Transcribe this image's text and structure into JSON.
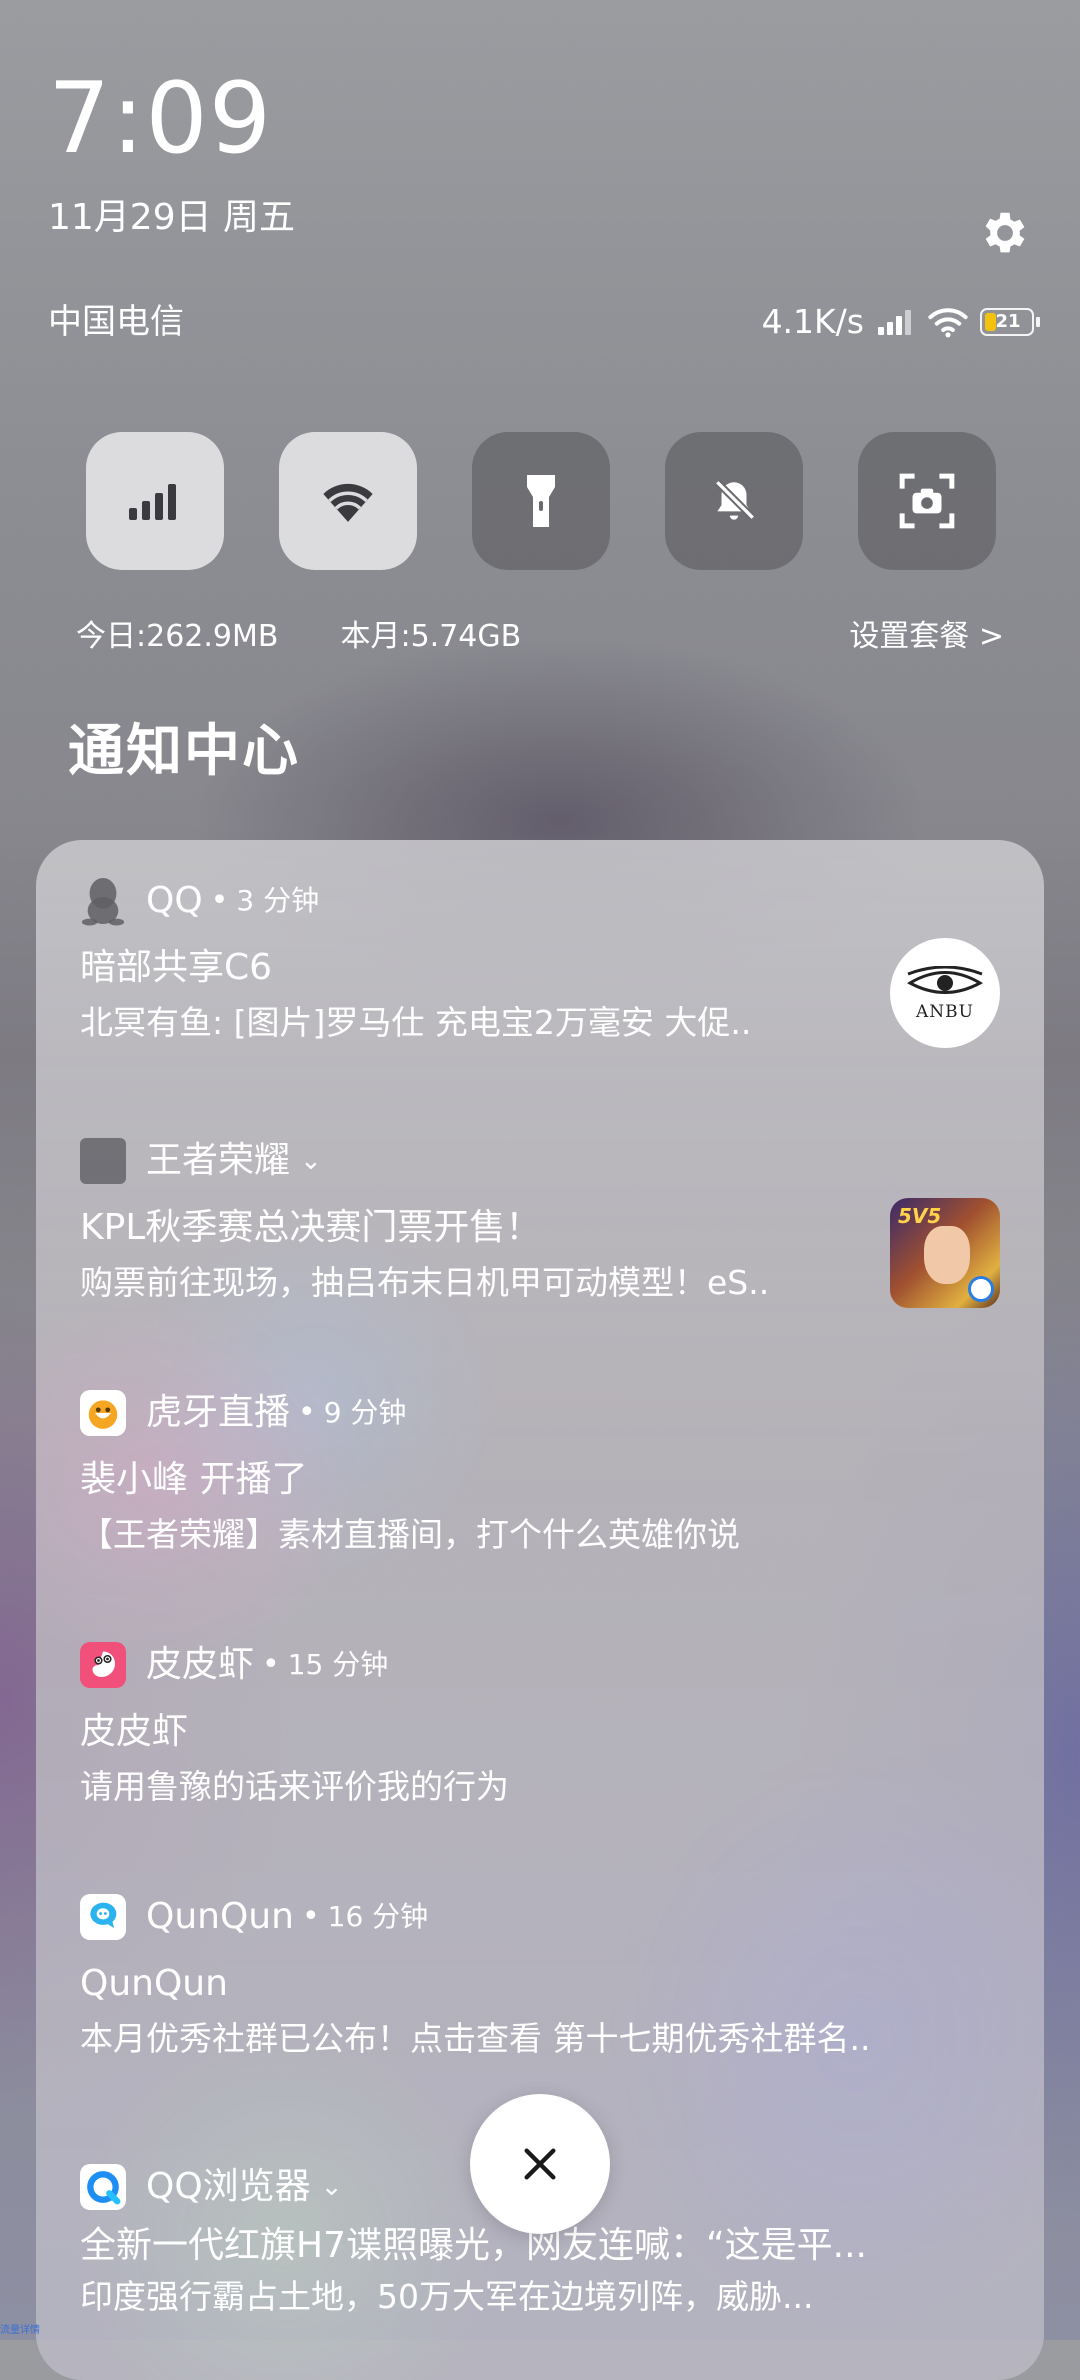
{
  "status": {
    "time": "7:09",
    "date": "11月29日 周五",
    "carrier": "中国电信",
    "net_speed": "4.1K/s",
    "battery": "21",
    "battery_level": 0.21
  },
  "quick_tiles": [
    {
      "icon": "cellular-data-icon",
      "active": true
    },
    {
      "icon": "wifi-icon",
      "active": true
    },
    {
      "icon": "flashlight-icon",
      "active": false
    },
    {
      "icon": "mute-bell-icon",
      "active": false
    },
    {
      "icon": "screenshot-icon",
      "active": false
    }
  ],
  "data_usage": {
    "today": "今日:262.9MB",
    "month": "本月:5.74GB",
    "plan_link": "设置套餐 >"
  },
  "notification_center": {
    "title": "通知中心",
    "notifications": [
      {
        "app": "QQ",
        "time": "3 分钟",
        "title": "暗部共享C6",
        "body": "北冥有鱼: [图片]罗马仕 充电宝2万毫安 大促..",
        "thumb_text": "ANBU"
      },
      {
        "app": "王者荣耀",
        "time": "",
        "title": "KPL秋季赛总决赛门票开售！",
        "body": "购票前往现场，抽吕布末日机甲可动模型！eS..",
        "thumb_text": "5V5"
      },
      {
        "app": "虎牙直播",
        "time": "9 分钟",
        "title": "裴小峰 开播了",
        "body": "【王者荣耀】素材直播间，打个什么英雄你说"
      },
      {
        "app": "皮皮虾",
        "time": "15 分钟",
        "title": "皮皮虾",
        "body": "请用鲁豫的话来评价我的行为"
      },
      {
        "app": "QunQun",
        "time": "16 分钟",
        "title": "QunQun",
        "body": "本月优秀社群已公布！点击查看 第十七期优秀社群名.."
      },
      {
        "app": "QQ浏览器",
        "time": "",
        "title": "全新一代红旗H7谍照曝光，网友连喊：“这是平...",
        "body": "印度强行霸占土地，50万大军在边境列阵，威胁..."
      }
    ]
  },
  "footer_text": "流量详情"
}
